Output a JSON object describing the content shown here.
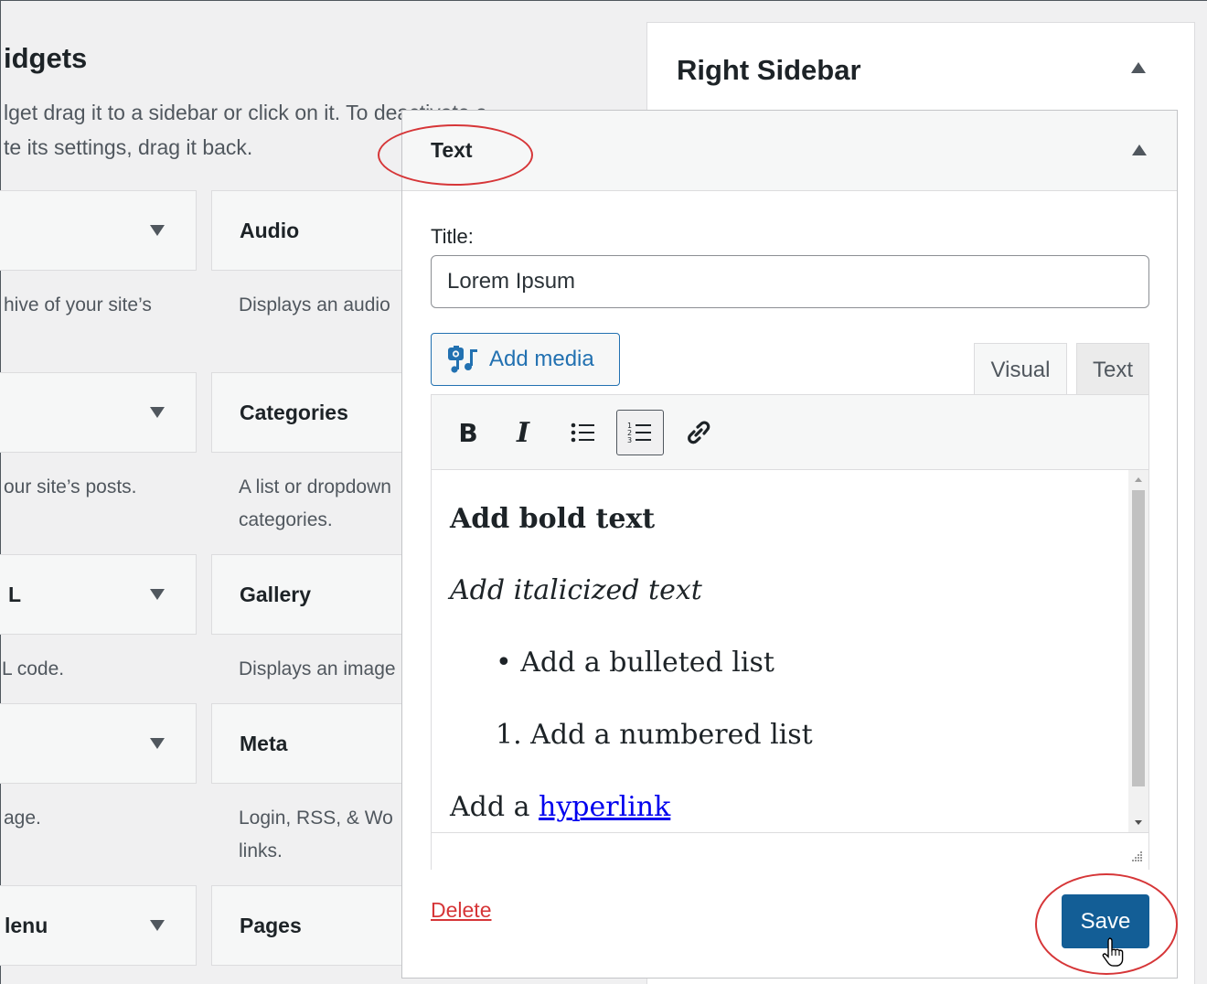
{
  "header": {
    "title": "idgets",
    "description_line1": "lget drag it to a sidebar or click on it. To deactivate a",
    "description_line2": "te its settings, drag it back."
  },
  "available_widgets": [
    {
      "left_title": "",
      "left_desc": "hive of your site’s",
      "right_title": "Audio",
      "right_desc": "Displays an audio"
    },
    {
      "left_title": "",
      "left_desc": "our site’s posts.",
      "right_title": "Categories",
      "right_desc": "A list or dropdown",
      "right_desc2": "categories."
    },
    {
      "left_title": "L",
      "left_desc": "L code.",
      "right_title": "Gallery",
      "right_desc": "Displays an image"
    },
    {
      "left_title": "",
      "left_desc": "age.",
      "right_title": "Meta",
      "right_desc": "Login, RSS, & Wo",
      "right_desc2": "links."
    },
    {
      "left_title": "lenu",
      "left_desc": "",
      "right_title": "Pages",
      "right_desc": ""
    }
  ],
  "sidebar": {
    "title": "Right Sidebar"
  },
  "text_widget": {
    "header_title": "Text",
    "title_label": "Title:",
    "title_value": "Lorem Ipsum",
    "add_media_label": "Add media",
    "tabs": {
      "visual": "Visual",
      "text": "Text"
    },
    "toolbar": {
      "bold": "B",
      "italic": "I"
    },
    "content": {
      "bold_text": "Add bold text",
      "italic_text": "Add italicized text",
      "bullet_item": "Add a bulleted list",
      "numbered_marker": "1.",
      "numbered_item": "Add a numbered list",
      "link_prefix": "Add a ",
      "link_text": "hyperlink"
    },
    "delete_label": "Delete",
    "save_label": "Save"
  },
  "colors": {
    "accent": "#2271b1",
    "save_button": "#135e96",
    "delete": "#d63638",
    "annotation_circle": "#d63638"
  }
}
